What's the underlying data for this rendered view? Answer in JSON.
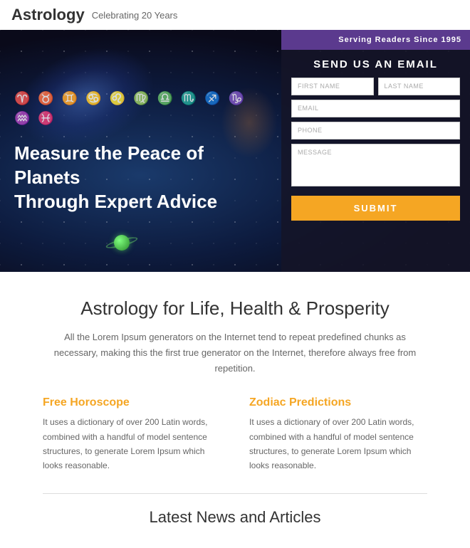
{
  "header": {
    "logo": "Astrology",
    "tagline": "Celebrating 20 Years"
  },
  "sidebar_banner": "Serving Readers Since 1995",
  "form": {
    "title": "SEND US AN EMAIL",
    "first_name_placeholder": "FIRST NAME",
    "last_name_placeholder": "LAST NAME",
    "email_placeholder": "EMAIL",
    "phone_placeholder": "PHONE",
    "message_placeholder": "Message",
    "submit_label": "SUBMIT"
  },
  "hero": {
    "zodiac_symbols": "♈ ♉ ♊ ♋ ♌ ♍ ♎ ♏ ♐ ♑ ♒ ♓",
    "headline_line1": "Measure the Peace of Planets",
    "headline_line2": "Through Expert Advice"
  },
  "main": {
    "section_title": "Astrology for Life, Health & Prosperity",
    "description": "All the Lorem Ipsum generators on the Internet tend to repeat predefined chunks as necessary, making this the first true generator on the Internet, therefore always free from repetition.",
    "col1_title": "Free Horoscope",
    "col1_text": "It uses a dictionary of over 200 Latin words, combined with a handful of model sentence structures, to generate Lorem Ipsum which looks reasonable.",
    "col2_title": "Zodiac Predictions",
    "col2_text": "It uses a dictionary of over 200 Latin words, combined with a handful of model sentence structures, to generate Lorem Ipsum which looks reasonable.",
    "latest_title": "Latest News and Articles"
  },
  "colors": {
    "orange": "#f5a623",
    "purple": "#5b3a8e"
  }
}
